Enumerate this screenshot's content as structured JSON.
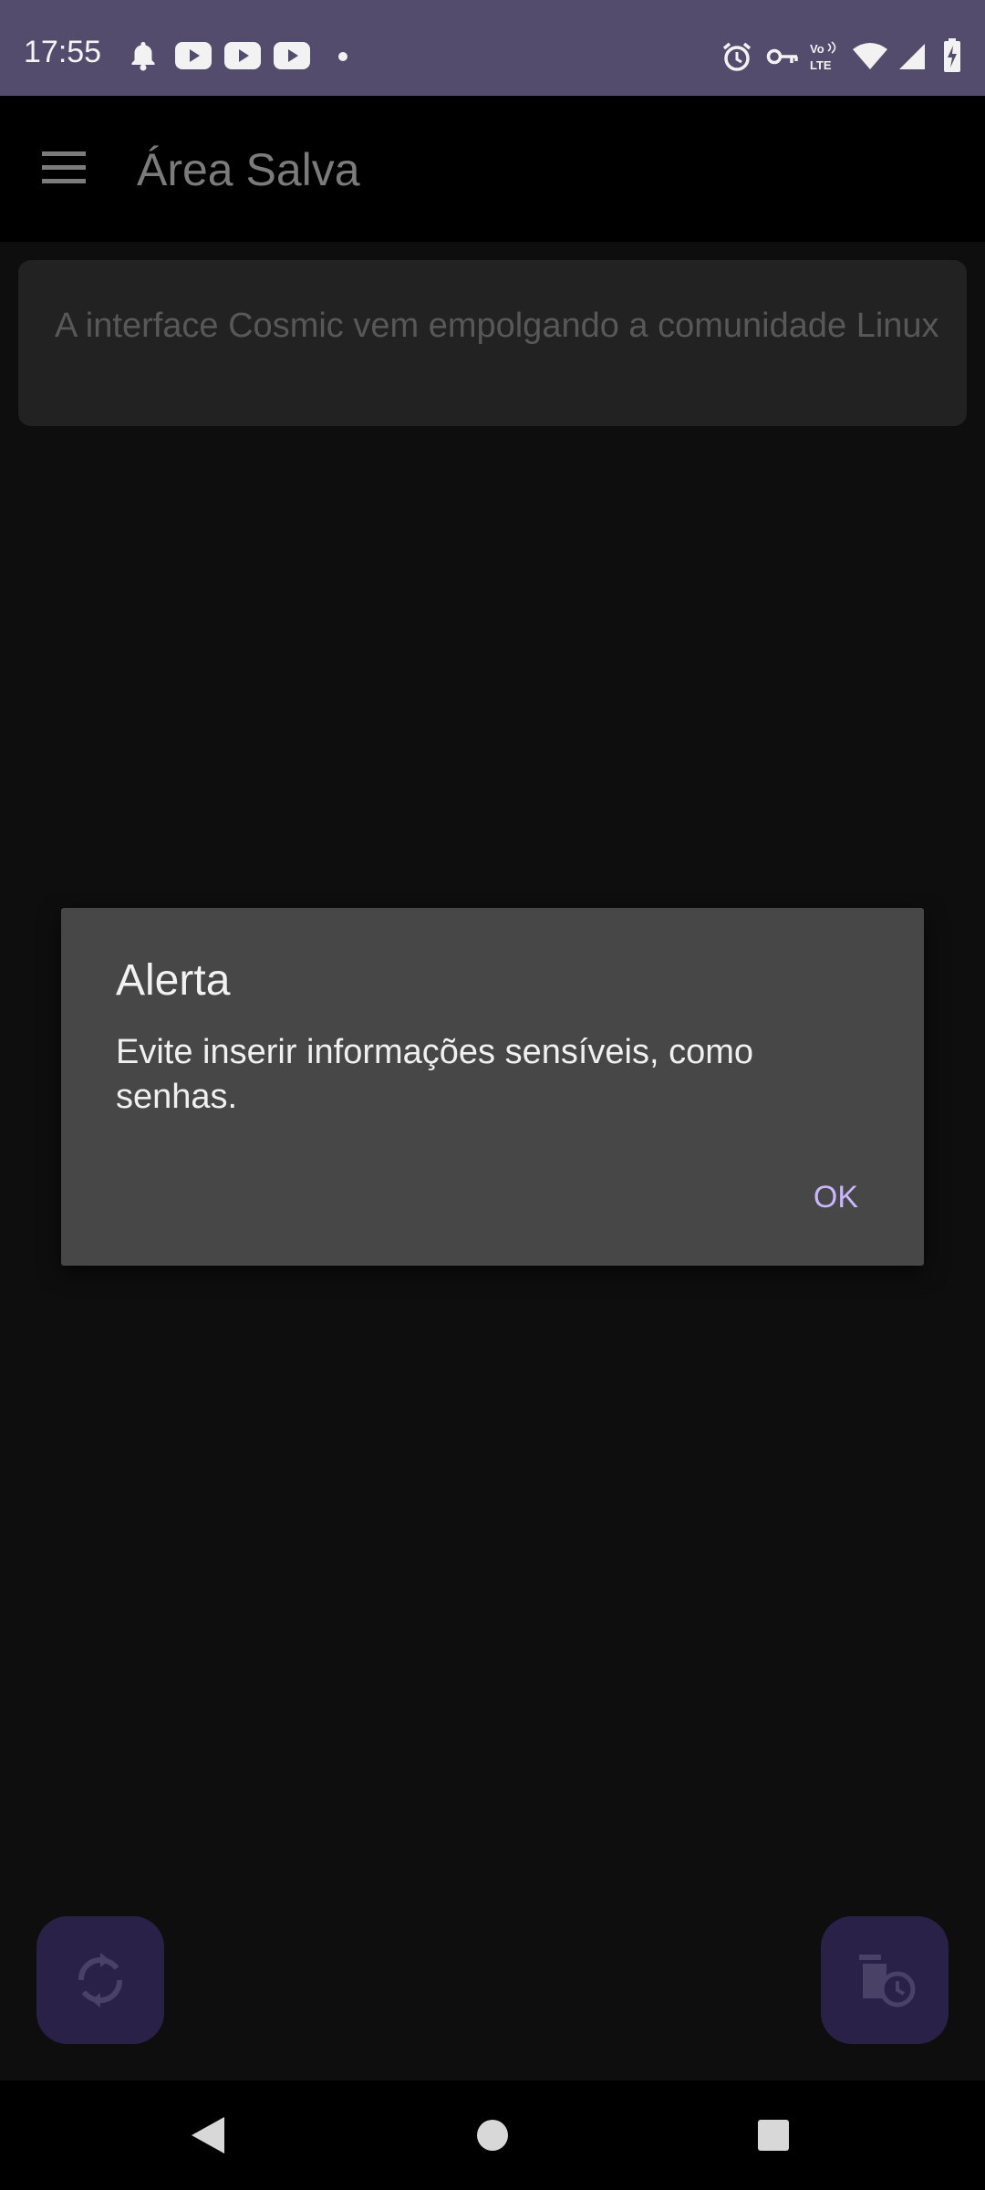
{
  "status_bar": {
    "time": "17:55",
    "left_icons": [
      "notification-bell-icon",
      "youtube-icon",
      "youtube-icon",
      "youtube-icon",
      "more-notifications-dot-icon"
    ],
    "right_icons": [
      "alarm-icon",
      "vpn-key-icon",
      "volte-icon",
      "wifi-icon",
      "signal-icon",
      "battery-charging-icon"
    ],
    "volte_label_top": "Vo",
    "volte_label_bottom": "LTE",
    "background": "#544c6c"
  },
  "app_bar": {
    "title": "Área Salva",
    "menu_icon": "hamburger-menu-icon"
  },
  "note": {
    "text": "A interface Cosmic vem empolgando a comunidade Linux"
  },
  "dialog": {
    "title": "Alerta",
    "message": "Evite inserir informações sensíveis, como senhas.",
    "ok_label": "OK",
    "accent_color": "#cbb6ff"
  },
  "fabs": {
    "left_icon": "refresh-icon",
    "right_icon": "delete-schedule-icon",
    "color": "#2a2148"
  },
  "nav_bar": {
    "icons": [
      "back-icon",
      "home-icon",
      "recents-icon"
    ]
  }
}
